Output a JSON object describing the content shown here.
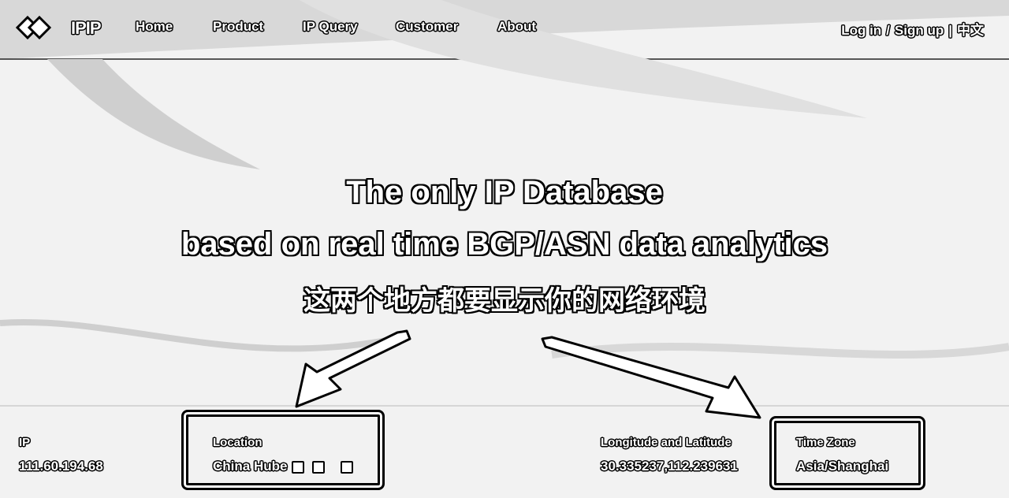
{
  "nav": {
    "logo_text": "IPIP",
    "links": [
      "Home",
      "Product",
      "IP Query",
      "Customer",
      "About"
    ],
    "login": "Log in",
    "divider1": "/",
    "signup": "Sign up",
    "divider2": "|",
    "language": "中文"
  },
  "hero": {
    "line1": "The only IP Database",
    "line2": "based on real time BGP/ASN data analytics",
    "annotation": "这两个地方都要显示你的网络环境"
  },
  "info": {
    "ip_label": "IP",
    "ip_value": "111.60.194.68",
    "location_label": "Location",
    "location_value": "China Hube",
    "coords_label": "Longitude and Latitude",
    "coords_value": "30.335237,112.239631",
    "timezone_label": "Time Zone",
    "timezone_value": "Asia/Shanghai"
  }
}
